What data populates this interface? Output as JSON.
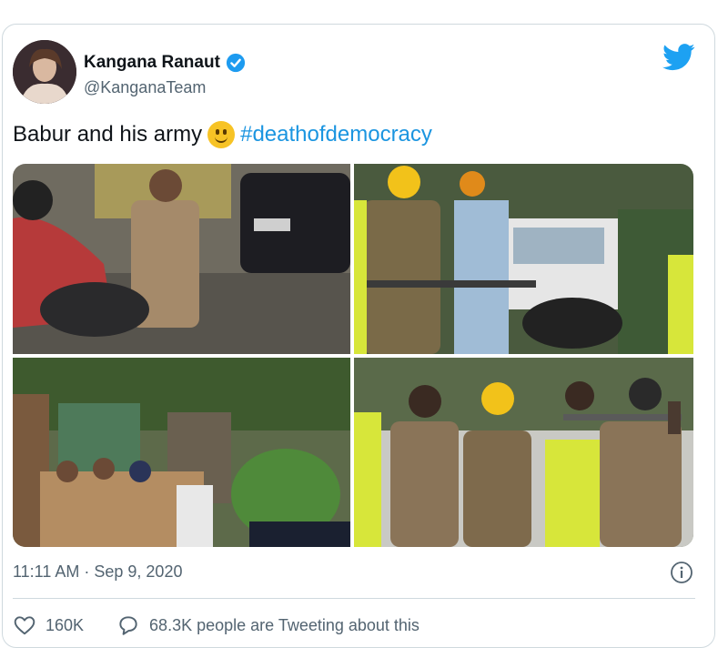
{
  "user": {
    "name": "Kangana Ranaut",
    "handle": "@KanganaTeam"
  },
  "tweet": {
    "text": "Babur and his army",
    "hashtag": "#deathofdemocracy",
    "timestamp": "11:11 AM · Sep 9, 2020"
  },
  "stats": {
    "likes": "160K",
    "tweeting": "68.3K people are Tweeting about this"
  },
  "icons": {
    "verified": "verified-badge-icon",
    "bird": "twitter-bird-icon",
    "emoji": "slightly-smiling-face-emoji",
    "info": "info-icon",
    "like": "heart-icon",
    "reply": "speech-bubble-icon"
  },
  "colors": {
    "accent": "#1b95e0",
    "muted": "#536471",
    "border": "#cfd9de"
  }
}
